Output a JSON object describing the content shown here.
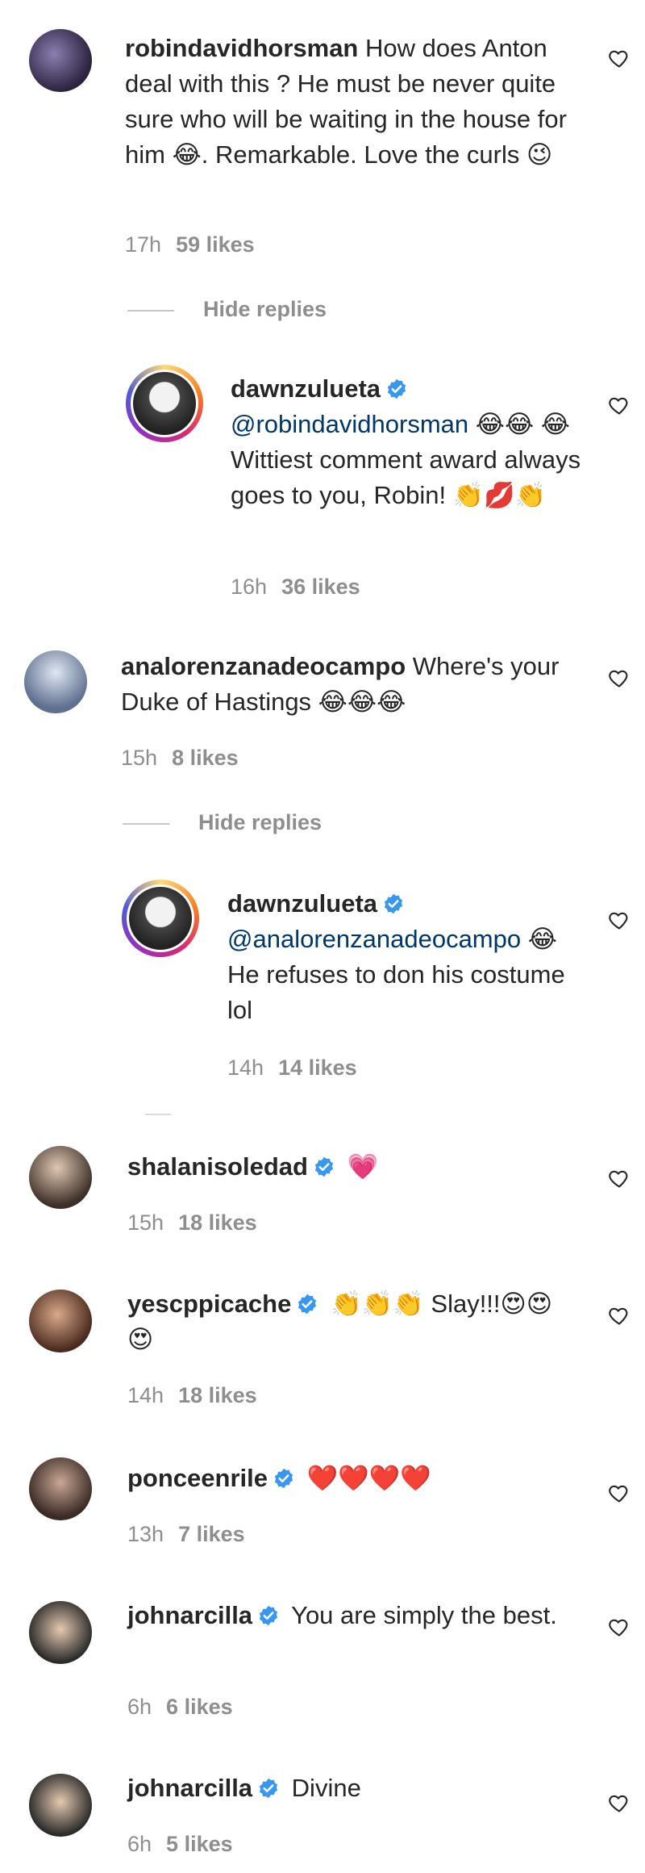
{
  "comments": [
    {
      "username": "robindavidhorsman",
      "text_line1": "How does",
      "text_rest": "Anton deal with this ? He must be never quite sure who will be waiting in the house for him 😂. Remarkable. Love the curls 😉",
      "time": "17h",
      "likes": "59 likes",
      "hide_replies": "Hide replies",
      "reply": {
        "username": "dawnzulueta",
        "mention": "@robindavidhorsman",
        "text": "😂😂 😂 Wittiest comment award always goes to you, Robin! 👏💋👏",
        "time": "16h",
        "likes": "36 likes"
      }
    },
    {
      "username": "analorenzanadeocampo",
      "text": "Where's your Duke of Hastings 😂😂😂",
      "time": "15h",
      "likes": "8 likes",
      "hide_replies": "Hide replies",
      "reply": {
        "username": "dawnzulueta",
        "mention": "@analorenzanadeocampo",
        "text": "😂 He refuses to don his costume lol",
        "time": "14h",
        "likes": "14 likes"
      }
    },
    {
      "username": "shalanisoledad",
      "text": "💗",
      "time": "15h",
      "likes": "18 likes"
    },
    {
      "username": "yescppicache",
      "text": "👏👏👏 Slay!!!😍😍 😍",
      "time": "14h",
      "likes": "18 likes"
    },
    {
      "username": "ponceenrile",
      "text": "❤️❤️❤️❤️",
      "time": "13h",
      "likes": "7 likes"
    },
    {
      "username": "johnarcilla",
      "text": "You are simply the best.",
      "time": "6h",
      "likes": "6 likes"
    },
    {
      "username": "johnarcilla",
      "text": "Divine",
      "time": "6h",
      "likes": "5 likes"
    }
  ],
  "colors": {
    "verified": "#3897f0",
    "mention": "#00376b",
    "meta": "#8e8e8e"
  },
  "icons": {
    "like": "heart-outline-icon",
    "verified": "verified-badge-icon"
  }
}
